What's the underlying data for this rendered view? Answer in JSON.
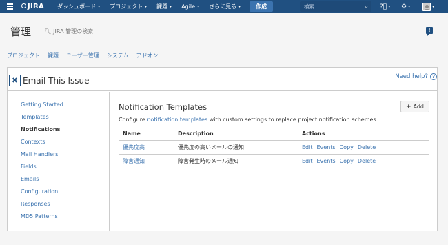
{
  "topnav": {
    "logo_text": "JIRA",
    "items": [
      {
        "label": "ダッシュボード"
      },
      {
        "label": "プロジェクト"
      },
      {
        "label": "課題"
      },
      {
        "label": "Agile"
      },
      {
        "label": "さらに見る"
      }
    ],
    "create_label": "作成",
    "search_placeholder": "検索"
  },
  "admin": {
    "title": "管理",
    "search_label": "JIRA 管理の検索",
    "tabs": [
      {
        "label": "プロジェクト"
      },
      {
        "label": "課題"
      },
      {
        "label": "ユーザー管理"
      },
      {
        "label": "システム"
      },
      {
        "label": "アドオン"
      }
    ]
  },
  "plugin": {
    "title": "Email This Issue",
    "need_help": "Need help?"
  },
  "sidebar": {
    "items": [
      {
        "label": "Getting Started"
      },
      {
        "label": "Templates"
      },
      {
        "label": "Notifications"
      },
      {
        "label": "Contexts"
      },
      {
        "label": "Mail Handlers"
      },
      {
        "label": "Fields"
      },
      {
        "label": "Emails"
      },
      {
        "label": "Configuration"
      },
      {
        "label": "Responses"
      },
      {
        "label": "MD5 Patterns"
      }
    ],
    "active": "Notifications"
  },
  "main": {
    "title": "Notification Templates",
    "add_label": "Add",
    "desc_pre": "Configure ",
    "desc_link": "notification templates",
    "desc_post": " with custom settings to replace project notification schemes.",
    "columns": {
      "name": "Name",
      "description": "Description",
      "actions": "Actions"
    },
    "rows": [
      {
        "name": "優先度高",
        "description": "優先度の高いメールの通知"
      },
      {
        "name": "障害通知",
        "description": "障害発生時のメール通知"
      }
    ],
    "actions": {
      "edit": "Edit",
      "events": "Events",
      "copy": "Copy",
      "delete": "Delete"
    }
  }
}
